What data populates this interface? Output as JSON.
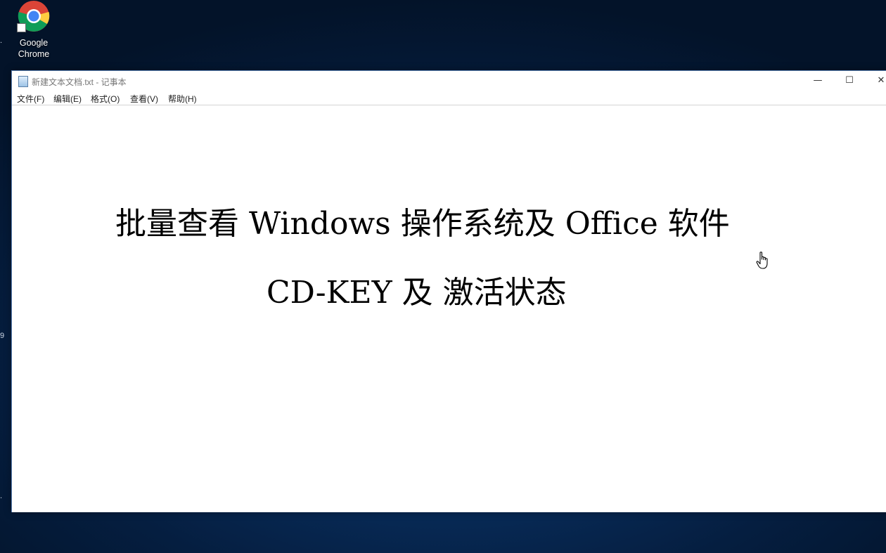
{
  "desktop": {
    "icons": [
      {
        "label_line1": "Google",
        "label_line2": "Chrome",
        "icon": "chrome-icon"
      }
    ],
    "edge_glyphs": [
      ".",
      "9",
      "."
    ]
  },
  "window": {
    "title": "新建文本文档.txt - 记事本",
    "controls": {
      "minimize": "—",
      "maximize": "☐",
      "close": "✕"
    },
    "menu": [
      "文件(F)",
      "编辑(E)",
      "格式(O)",
      "查看(V)",
      "帮助(H)"
    ],
    "document": {
      "lines": [
        "批量查看 Windows 操作系统及 Office 软件",
        "CD-KEY 及 激活状态"
      ]
    }
  },
  "colors": {
    "desktop_bg": "#082c5a",
    "window_border": "#5a7fb0",
    "text": "#000000"
  }
}
